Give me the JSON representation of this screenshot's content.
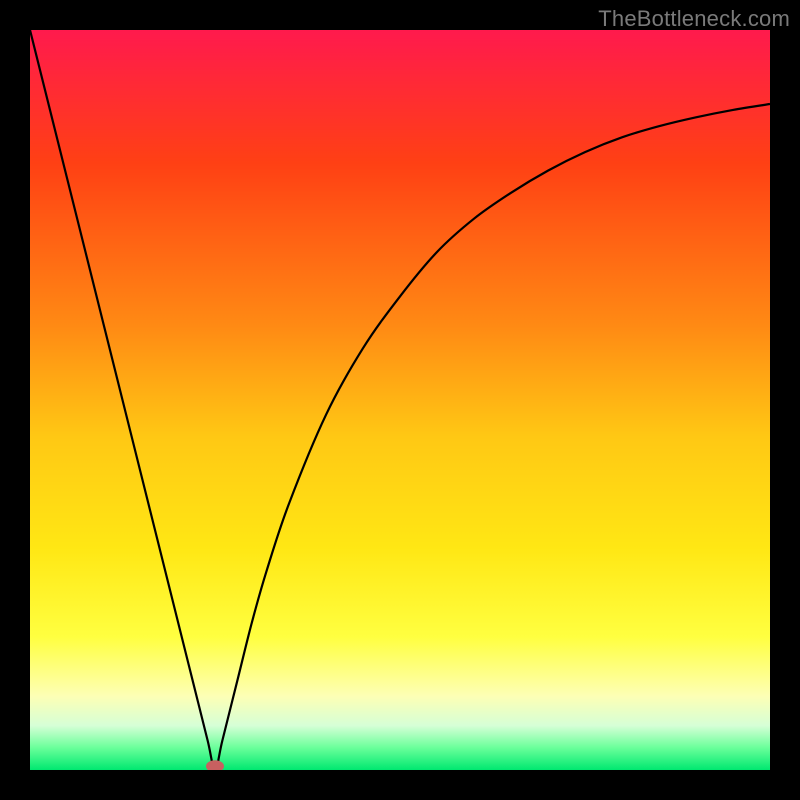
{
  "attribution": "TheBottleneck.com",
  "chart_data": {
    "type": "line",
    "title": "",
    "xlabel": "",
    "ylabel": "",
    "xlim": [
      0,
      100
    ],
    "ylim": [
      0,
      100
    ],
    "x_min_at": 25,
    "series": [
      {
        "name": "curve",
        "x": [
          0,
          5,
          10,
          15,
          20,
          22,
          24,
          25,
          26,
          28,
          30,
          32,
          35,
          40,
          45,
          50,
          55,
          60,
          65,
          70,
          75,
          80,
          85,
          90,
          95,
          100
        ],
        "y": [
          100,
          80,
          60,
          40,
          20,
          12,
          4,
          0,
          4,
          12,
          20,
          27,
          36,
          48,
          57,
          64,
          70,
          74.5,
          78,
          81,
          83.5,
          85.5,
          87,
          88.2,
          89.2,
          90
        ]
      }
    ],
    "marker": {
      "x": 25,
      "y": 0.5,
      "color_hex": "#c86060"
    },
    "gradient_stops": [
      {
        "offset": 0.0,
        "color_hex": "#ff1a4d"
      },
      {
        "offset": 0.18,
        "color_hex": "#ff4014"
      },
      {
        "offset": 0.4,
        "color_hex": "#ff8a14"
      },
      {
        "offset": 0.55,
        "color_hex": "#ffc814"
      },
      {
        "offset": 0.7,
        "color_hex": "#ffe714"
      },
      {
        "offset": 0.82,
        "color_hex": "#ffff40"
      },
      {
        "offset": 0.9,
        "color_hex": "#fdffb5"
      },
      {
        "offset": 0.94,
        "color_hex": "#d6ffd6"
      },
      {
        "offset": 0.97,
        "color_hex": "#6aff9a"
      },
      {
        "offset": 1.0,
        "color_hex": "#00e870"
      }
    ],
    "curve_color_hex": "#000000",
    "background_color_hex": "#000000"
  }
}
